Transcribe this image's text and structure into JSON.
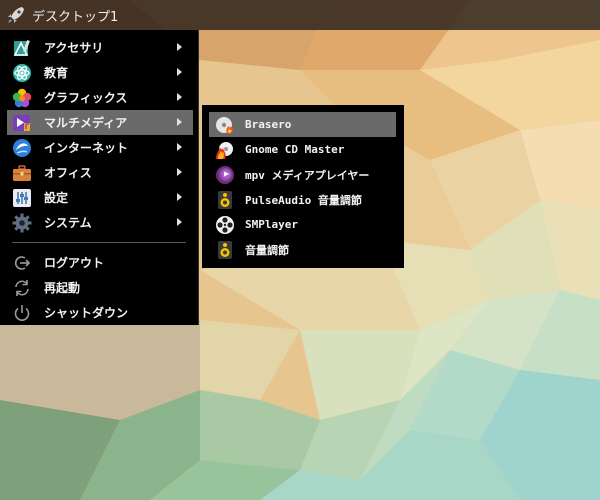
{
  "taskbar": {
    "title": "デスクトップ1",
    "launcher_icon": "rocket-icon"
  },
  "main_menu": {
    "items": [
      {
        "label": "アクセサリ",
        "icon": "accessories-icon",
        "has_submenu": true
      },
      {
        "label": "教育",
        "icon": "education-icon",
        "has_submenu": true
      },
      {
        "label": "グラフィックス",
        "icon": "graphics-icon",
        "has_submenu": true
      },
      {
        "label": "マルチメディア",
        "icon": "multimedia-icon",
        "has_submenu": true,
        "active": true
      },
      {
        "label": "インターネット",
        "icon": "internet-icon",
        "has_submenu": true
      },
      {
        "label": "オフィス",
        "icon": "office-icon",
        "has_submenu": true
      },
      {
        "label": "設定",
        "icon": "settings-icon",
        "has_submenu": true
      },
      {
        "label": "システム",
        "icon": "system-icon",
        "has_submenu": true
      }
    ],
    "session": [
      {
        "label": "ログアウト",
        "icon": "logout-icon"
      },
      {
        "label": "再起動",
        "icon": "restart-icon"
      },
      {
        "label": "シャットダウン",
        "icon": "shutdown-icon"
      }
    ]
  },
  "submenu": {
    "items": [
      {
        "label": "Brasero",
        "icon": "brasero-icon",
        "active": true
      },
      {
        "label": "Gnome CD Master",
        "icon": "gnome-cd-master-icon"
      },
      {
        "label": "mpv メディアプレイヤー",
        "icon": "mpv-icon"
      },
      {
        "label": "PulseAudio 音量調節",
        "icon": "speaker-icon"
      },
      {
        "label": "SMPlayer",
        "icon": "smplayer-icon"
      },
      {
        "label": "音量調節",
        "icon": "speaker-icon"
      }
    ]
  },
  "colors": {
    "menu_bg": "#000000",
    "highlight": "#6a6a6a",
    "taskbar": "#28201a"
  }
}
